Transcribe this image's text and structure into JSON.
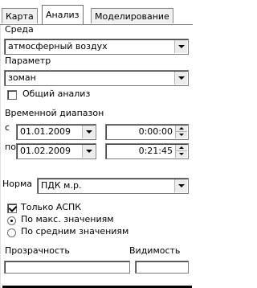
{
  "tabs": [
    {
      "label": "Карта"
    },
    {
      "label": "Анализ"
    },
    {
      "label": "Моделирование"
    }
  ],
  "sreda": {
    "label": "Среда",
    "value": "атмосферный воздух"
  },
  "parametr": {
    "label": "Параметр",
    "value": "зоман"
  },
  "obshiy": {
    "label": "Общий анализ",
    "checked": false
  },
  "diapazon": {
    "label": "Временной диапазон",
    "from_prefix": "с",
    "from_date": "01.01.2009",
    "from_time": "0:00:00",
    "to_prefix": "по",
    "to_date": "01.02.2009",
    "to_time": "0:21:45"
  },
  "norma": {
    "label": "Норма",
    "value": "ПДК м.р."
  },
  "tolko_aspk": {
    "label": "Только АСПК",
    "checked": true
  },
  "radio": [
    {
      "label": "По макс. значениям",
      "selected": true
    },
    {
      "label": "По средним значениям",
      "selected": false
    }
  ],
  "prozrachnost": {
    "label": "Прозрачность"
  },
  "vidimost": {
    "label": "Видимость"
  }
}
